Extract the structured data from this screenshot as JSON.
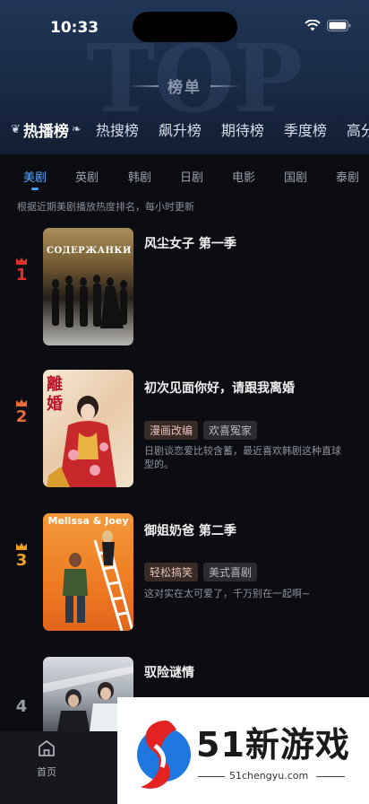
{
  "status": {
    "time": "10:33"
  },
  "header": {
    "bg_text": "TOP",
    "title": "榜单",
    "tabs": [
      "热播榜",
      "热搜榜",
      "飙升榜",
      "期待榜",
      "季度榜",
      "高分"
    ]
  },
  "subtabs": [
    "美剧",
    "英剧",
    "韩剧",
    "日剧",
    "电影",
    "国剧",
    "泰剧"
  ],
  "note": "根据近期美剧播放热度排名，每小时更新",
  "items": [
    {
      "rank": "1",
      "title": "风尘女子 第一季",
      "poster_text": "СОДЕРЖАНКИ",
      "tags": [],
      "desc": ""
    },
    {
      "rank": "2",
      "title": "初次见面你好，请跟我离婚",
      "poster_text": "離婚",
      "tags": [
        "漫画改编",
        "欢喜冤家"
      ],
      "desc": "日剧谈恋爱比较含蓄，最近喜欢韩剧这种直球型的。"
    },
    {
      "rank": "3",
      "title": "御姐奶爸 第二季",
      "poster_text": "Melissa & Joey",
      "tags": [
        "轻松搞笑",
        "美式喜剧"
      ],
      "desc": "这对实在太可爱了，千万别在一起啊~"
    },
    {
      "rank": "4",
      "title": "驭险谜情",
      "poster_text": "",
      "tags": [],
      "desc": ""
    }
  ],
  "nav": {
    "home_label": "首页"
  },
  "watermark": {
    "text": "51新游戏",
    "url": "51chengyu.com"
  },
  "colors": {
    "accent": "#4d9dff",
    "rank1": "#e0302c",
    "rank2": "#e96a37",
    "rank3": "#f0a020",
    "rank4": "#9aa0a8"
  }
}
